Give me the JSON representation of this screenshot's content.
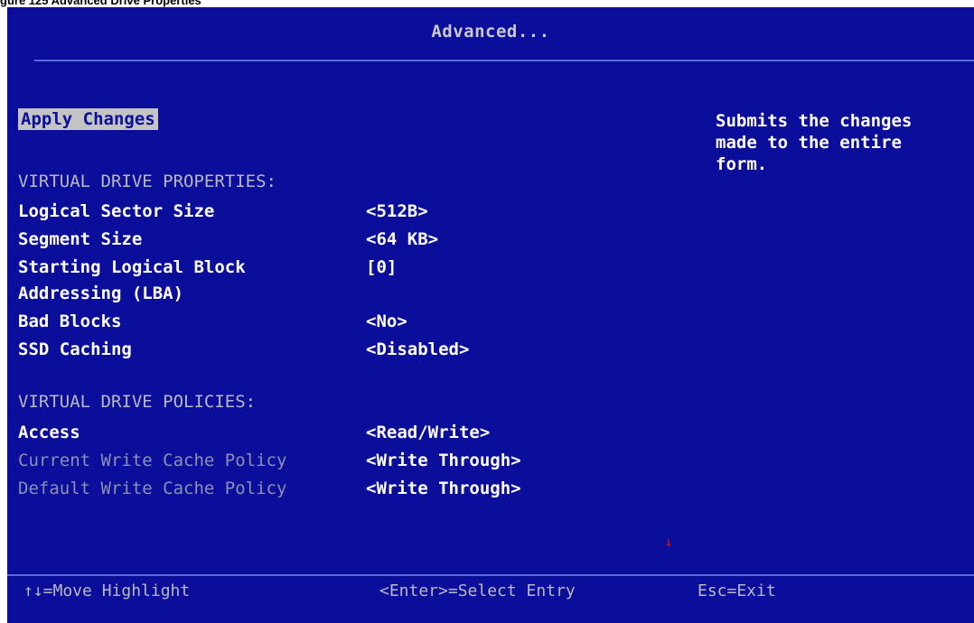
{
  "caption": "gure 125 Advanced Drive Properties",
  "title": "Advanced...",
  "apply_changes": "Apply Changes",
  "help_text": "Submits the changes\nmade to the entire\nform.",
  "sections": {
    "properties_header": "VIRTUAL DRIVE PROPERTIES:",
    "policies_header": "VIRTUAL DRIVE POLICIES:"
  },
  "properties": [
    {
      "label": "Logical Sector Size",
      "value": "<512B>"
    },
    {
      "label": "Segment Size",
      "value": "<64 KB>"
    },
    {
      "label": "Starting Logical Block",
      "label2": "Addressing (LBA)",
      "value": "[0]"
    },
    {
      "label": "Bad Blocks",
      "value": "<No>"
    },
    {
      "label": "SSD Caching",
      "value": "<Disabled>"
    }
  ],
  "policies": [
    {
      "label": "Access",
      "value": "<Read/Write>"
    },
    {
      "label": "Current Write Cache Policy",
      "value": "<Write Through>"
    },
    {
      "label": "Default Write Cache Policy",
      "value": "<Write Through>"
    }
  ],
  "footer": {
    "move": "↑↓=Move Highlight",
    "select": "<Enter>=Select Entry",
    "exit": "Esc=Exit"
  },
  "colors": {
    "background": "#0b0e9a",
    "highlight": "#c4c4c4",
    "scroll_indicator": "#e01010"
  },
  "icons": {
    "scroll_indicator": "down-arrow-icon"
  }
}
